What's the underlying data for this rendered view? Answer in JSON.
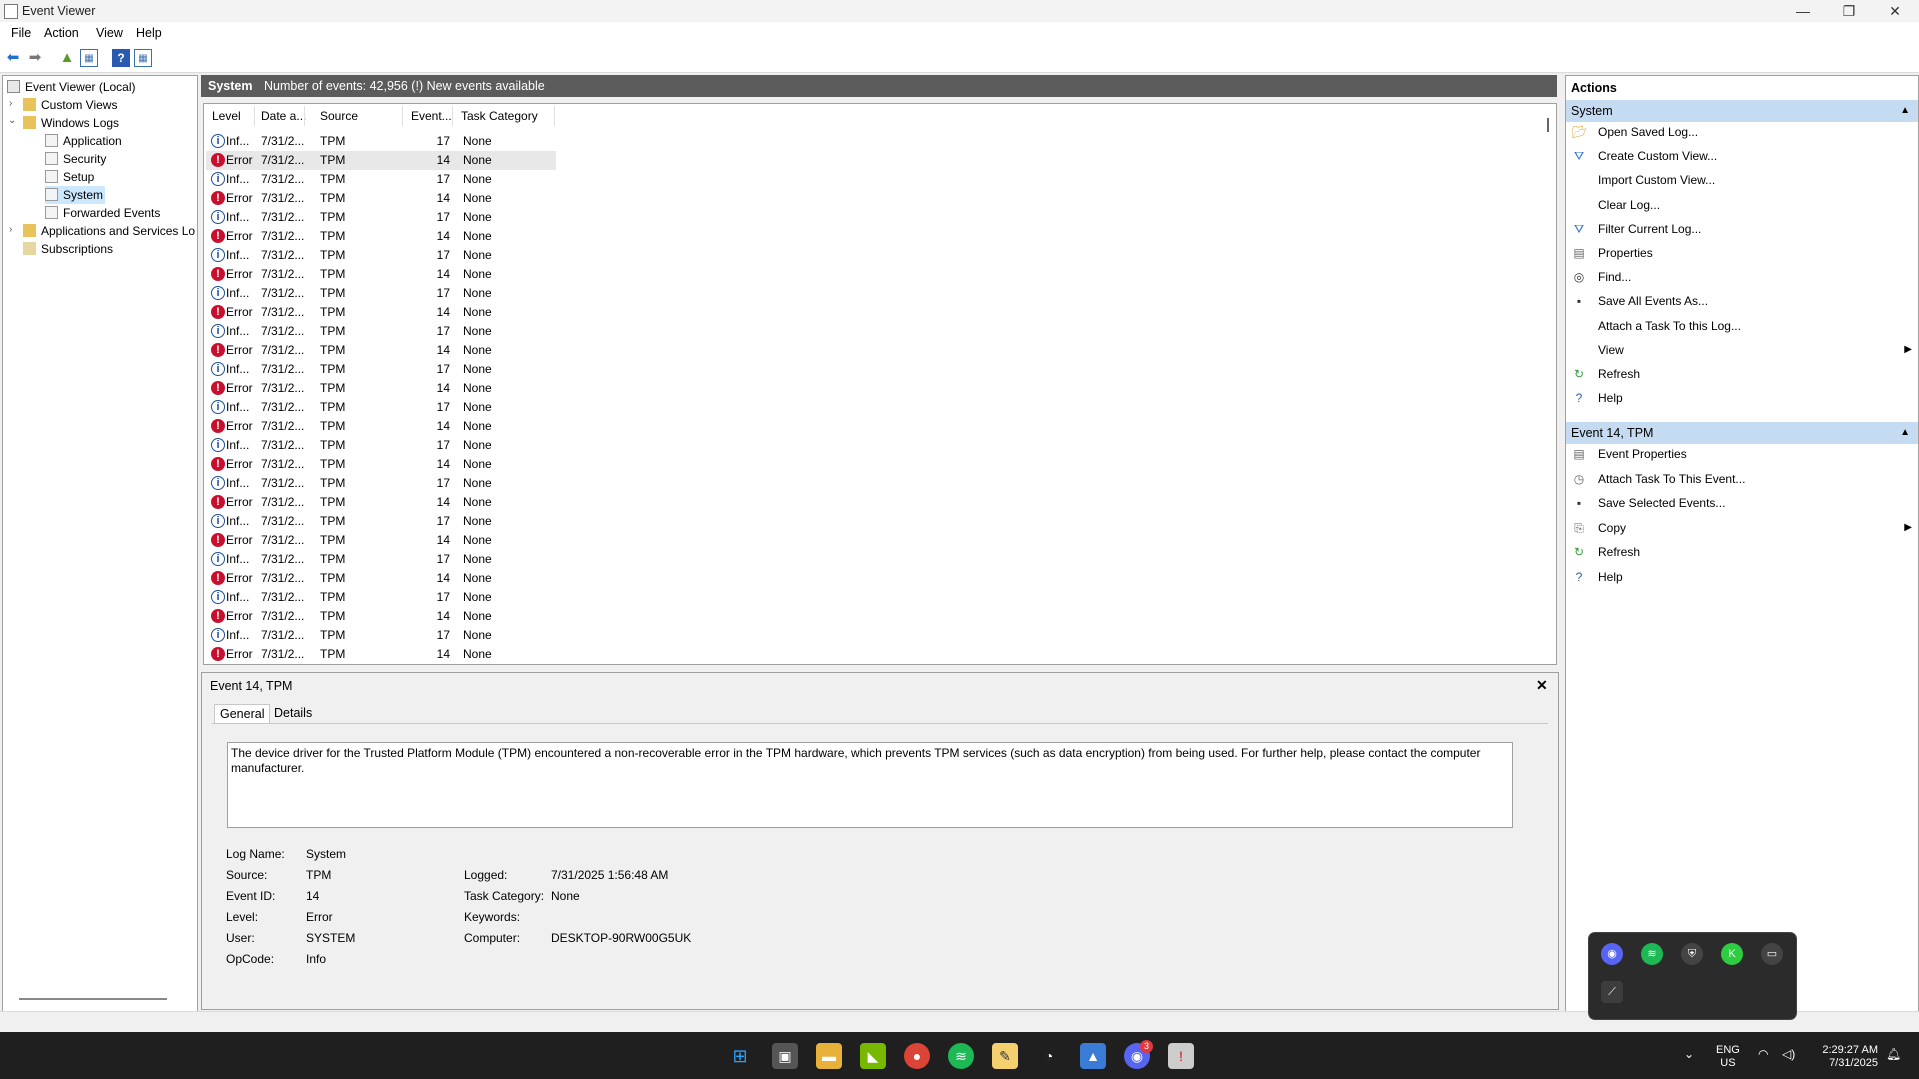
{
  "window": {
    "title": "Event Viewer"
  },
  "menu": [
    "File",
    "Action",
    "View",
    "Help"
  ],
  "tree": {
    "root": "Event Viewer (Local)",
    "custom_views": "Custom Views",
    "windows_logs": "Windows Logs",
    "logs": [
      "Application",
      "Security",
      "Setup",
      "System",
      "Forwarded Events"
    ],
    "app_services": "Applications and Services Lo",
    "subscriptions": "Subscriptions"
  },
  "log_header": {
    "name": "System",
    "summary": "Number of events: 42,956 (!) New events available"
  },
  "columns": [
    "Level",
    "Date a...",
    "Source",
    "Event...",
    "Task Category"
  ],
  "rows": [
    {
      "level": "Inf...",
      "date": "7/31/2...",
      "source": "TPM",
      "id": "17",
      "cat": "None"
    },
    {
      "level": "Error",
      "date": "7/31/2...",
      "source": "TPM",
      "id": "14",
      "cat": "None"
    },
    {
      "level": "Inf...",
      "date": "7/31/2...",
      "source": "TPM",
      "id": "17",
      "cat": "None"
    },
    {
      "level": "Error",
      "date": "7/31/2...",
      "source": "TPM",
      "id": "14",
      "cat": "None"
    },
    {
      "level": "Inf...",
      "date": "7/31/2...",
      "source": "TPM",
      "id": "17",
      "cat": "None"
    },
    {
      "level": "Error",
      "date": "7/31/2...",
      "source": "TPM",
      "id": "14",
      "cat": "None"
    },
    {
      "level": "Inf...",
      "date": "7/31/2...",
      "source": "TPM",
      "id": "17",
      "cat": "None"
    },
    {
      "level": "Error",
      "date": "7/31/2...",
      "source": "TPM",
      "id": "14",
      "cat": "None"
    },
    {
      "level": "Inf...",
      "date": "7/31/2...",
      "source": "TPM",
      "id": "17",
      "cat": "None"
    },
    {
      "level": "Error",
      "date": "7/31/2...",
      "source": "TPM",
      "id": "14",
      "cat": "None"
    },
    {
      "level": "Inf...",
      "date": "7/31/2...",
      "source": "TPM",
      "id": "17",
      "cat": "None"
    },
    {
      "level": "Error",
      "date": "7/31/2...",
      "source": "TPM",
      "id": "14",
      "cat": "None"
    },
    {
      "level": "Inf...",
      "date": "7/31/2...",
      "source": "TPM",
      "id": "17",
      "cat": "None"
    },
    {
      "level": "Error",
      "date": "7/31/2...",
      "source": "TPM",
      "id": "14",
      "cat": "None"
    },
    {
      "level": "Inf...",
      "date": "7/31/2...",
      "source": "TPM",
      "id": "17",
      "cat": "None"
    },
    {
      "level": "Error",
      "date": "7/31/2...",
      "source": "TPM",
      "id": "14",
      "cat": "None"
    },
    {
      "level": "Inf...",
      "date": "7/31/2...",
      "source": "TPM",
      "id": "17",
      "cat": "None"
    },
    {
      "level": "Error",
      "date": "7/31/2...",
      "source": "TPM",
      "id": "14",
      "cat": "None"
    },
    {
      "level": "Inf...",
      "date": "7/31/2...",
      "source": "TPM",
      "id": "17",
      "cat": "None"
    },
    {
      "level": "Error",
      "date": "7/31/2...",
      "source": "TPM",
      "id": "14",
      "cat": "None"
    },
    {
      "level": "Inf...",
      "date": "7/31/2...",
      "source": "TPM",
      "id": "17",
      "cat": "None"
    },
    {
      "level": "Error",
      "date": "7/31/2...",
      "source": "TPM",
      "id": "14",
      "cat": "None"
    },
    {
      "level": "Inf...",
      "date": "7/31/2...",
      "source": "TPM",
      "id": "17",
      "cat": "None"
    },
    {
      "level": "Error",
      "date": "7/31/2...",
      "source": "TPM",
      "id": "14",
      "cat": "None"
    },
    {
      "level": "Inf...",
      "date": "7/31/2...",
      "source": "TPM",
      "id": "17",
      "cat": "None"
    },
    {
      "level": "Error",
      "date": "7/31/2...",
      "source": "TPM",
      "id": "14",
      "cat": "None"
    },
    {
      "level": "Inf...",
      "date": "7/31/2...",
      "source": "TPM",
      "id": "17",
      "cat": "None"
    },
    {
      "level": "Error",
      "date": "7/31/2...",
      "source": "TPM",
      "id": "14",
      "cat": "None"
    }
  ],
  "detail": {
    "title": "Event 14, TPM",
    "tabs": [
      "General",
      "Details"
    ],
    "description": "The device driver for the Trusted Platform Module (TPM) encountered a non-recoverable error in the TPM hardware, which prevents TPM services (such as data encryption) from being used. For further help, please contact the computer manufacturer.",
    "fields": {
      "log_name_label": "Log Name:",
      "log_name": "System",
      "source_label": "Source:",
      "source": "TPM",
      "event_id_label": "Event ID:",
      "event_id": "14",
      "level_label": "Level:",
      "level": "Error",
      "user_label": "User:",
      "user": "SYSTEM",
      "opcode_label": "OpCode:",
      "opcode": "Info",
      "logged_label": "Logged:",
      "logged": "7/31/2025 1:56:48 AM",
      "task_cat_label": "Task Category:",
      "task_cat": "None",
      "keywords_label": "Keywords:",
      "keywords": "",
      "computer_label": "Computer:",
      "computer": "DESKTOP-90RW00G5UK"
    }
  },
  "actions": {
    "header": "Actions",
    "section1": "System",
    "items1": [
      "Open Saved Log...",
      "Create Custom View...",
      "Import Custom View...",
      "Clear Log...",
      "Filter Current Log...",
      "Properties",
      "Find...",
      "Save All Events As...",
      "Attach a Task To this Log...",
      "View",
      "Refresh",
      "Help"
    ],
    "section2": "Event 14, TPM",
    "items2": [
      "Event Properties",
      "Attach Task To This Event...",
      "Save Selected Events...",
      "Copy",
      "Refresh",
      "Help"
    ]
  },
  "taskbar": {
    "lang1": "ENG",
    "lang2": "US",
    "time": "2:29:27 AM",
    "date": "7/31/2025",
    "discord_badge": "3"
  },
  "colors": {
    "accent": "#0078d4",
    "section": "#c5dbf2",
    "error": "#c8102e",
    "info": "#1b4f9c"
  }
}
